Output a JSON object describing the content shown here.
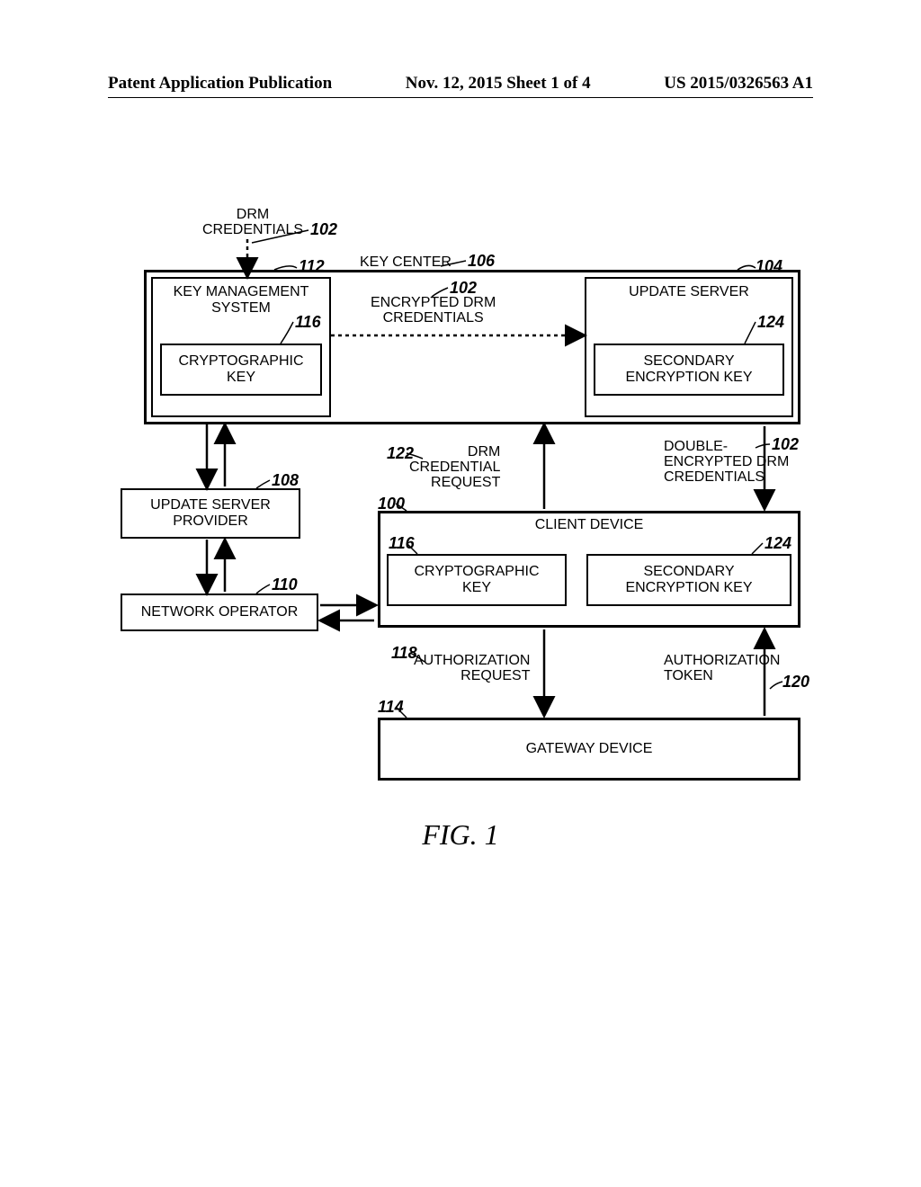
{
  "header": {
    "left": "Patent Application Publication",
    "center": "Nov. 12, 2015  Sheet 1 of 4",
    "right": "US 2015/0326563 A1"
  },
  "labels": {
    "drm_credentials": "DRM\nCREDENTIALS",
    "key_center": "KEY CENTER",
    "key_mgmt": "KEY MANAGEMENT\nSYSTEM",
    "crypto_key": "CRYPTOGRAPHIC\nKEY",
    "update_server": "UPDATE SERVER",
    "secondary_key": "SECONDARY\nENCRYPTION KEY",
    "encrypted_drm": "ENCRYPTED DRM\nCREDENTIALS",
    "update_provider": "UPDATE SERVER\nPROVIDER",
    "network_operator": "NETWORK OPERATOR",
    "drm_request": "DRM\nCREDENTIAL\nREQUEST",
    "double_encrypted": "DOUBLE-\nENCRYPTED DRM\nCREDENTIALS",
    "client_device": "CLIENT DEVICE",
    "auth_request": "AUTHORIZATION\nREQUEST",
    "auth_token": "AUTHORIZATION\nTOKEN",
    "gateway": "GATEWAY DEVICE"
  },
  "refs": {
    "r102a": "102",
    "r106": "106",
    "r112": "112",
    "r104": "104",
    "r116a": "116",
    "r102b": "102",
    "r124a": "124",
    "r108": "108",
    "r122": "122",
    "r102c": "102",
    "r100": "100",
    "r116b": "116",
    "r124b": "124",
    "r110": "110",
    "r118": "118",
    "r120": "120",
    "r114": "114"
  },
  "figure": "FIG. 1"
}
